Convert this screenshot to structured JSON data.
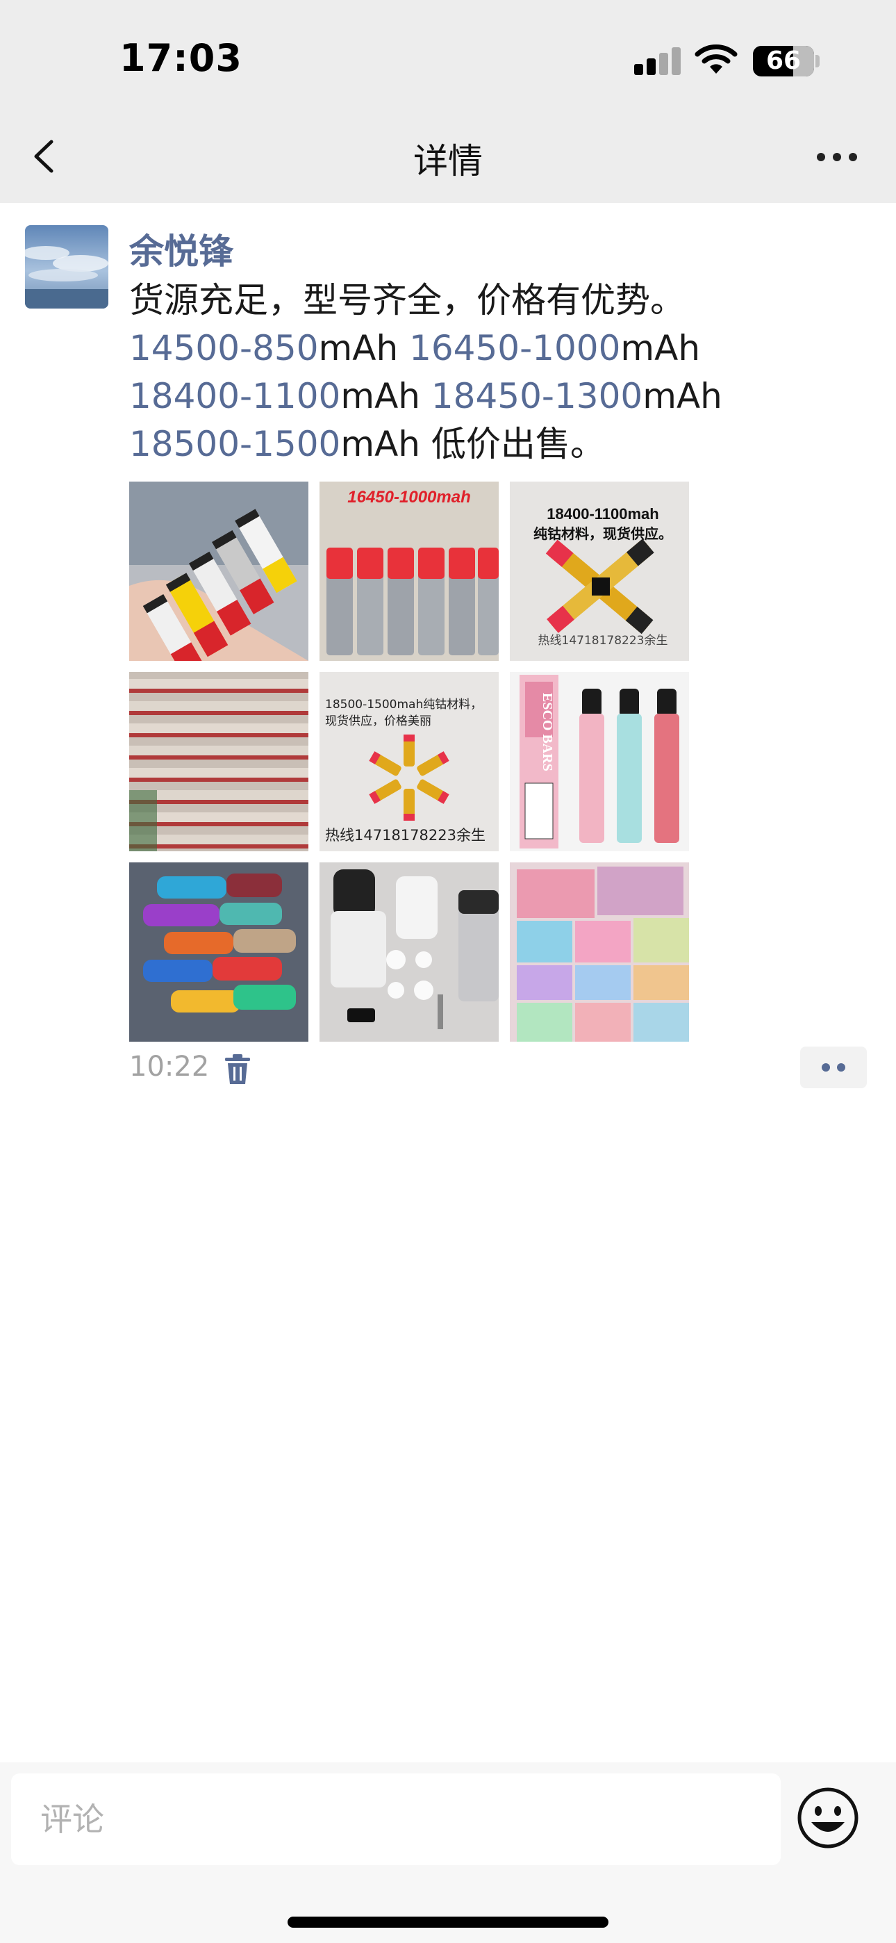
{
  "status_bar": {
    "time": "17:03",
    "battery": "66",
    "icons": [
      "cellular-signal-icon",
      "wifi-icon",
      "battery-icon"
    ]
  },
  "nav": {
    "title": "详情",
    "back_icon": "chevron-left-icon",
    "more_icon": "more-dots-icon"
  },
  "post": {
    "author": "余悦锋",
    "text_line1": "货源充足，型号齐全，价格有优势。",
    "specs": [
      {
        "code": "14500-850",
        "unit": "mAh"
      },
      {
        "code": "16450-1000",
        "unit": "mAh"
      },
      {
        "code": "18400-1100",
        "unit": "mAh"
      },
      {
        "code": "18450-1300",
        "unit": "mAh"
      },
      {
        "code": "18500-1500",
        "unit": "mAh"
      }
    ],
    "text_tail": "低价出售。",
    "images": [
      {
        "name": "batteries-in-hand"
      },
      {
        "name": "red-cap-batteries",
        "caption": "16450-1000mah"
      },
      {
        "name": "crossed-batteries",
        "caption": "18400-1100mah",
        "caption2": "纯钴材料，现货供应。",
        "footer": "热线14718178223余生"
      },
      {
        "name": "battery-rows"
      },
      {
        "name": "battery-star",
        "caption": "18500-1500mah纯钴材料，",
        "caption2": "现货供应，价格美丽",
        "footer": "热线14718178223余生"
      },
      {
        "name": "vape-pens",
        "box_text": "ESCO BARS"
      },
      {
        "name": "colored-tubes"
      },
      {
        "name": "device-parts"
      },
      {
        "name": "vape-boxes"
      }
    ],
    "time": "10:22",
    "delete_icon": "trash-icon",
    "comment_icon": "comment-dots-icon"
  },
  "comment_bar": {
    "placeholder": "评论",
    "emoji_icon": "smiley-icon"
  },
  "colors": {
    "link": "#576b95",
    "nav_bg": "#ededed",
    "bar_bg": "#f7f7f7"
  }
}
